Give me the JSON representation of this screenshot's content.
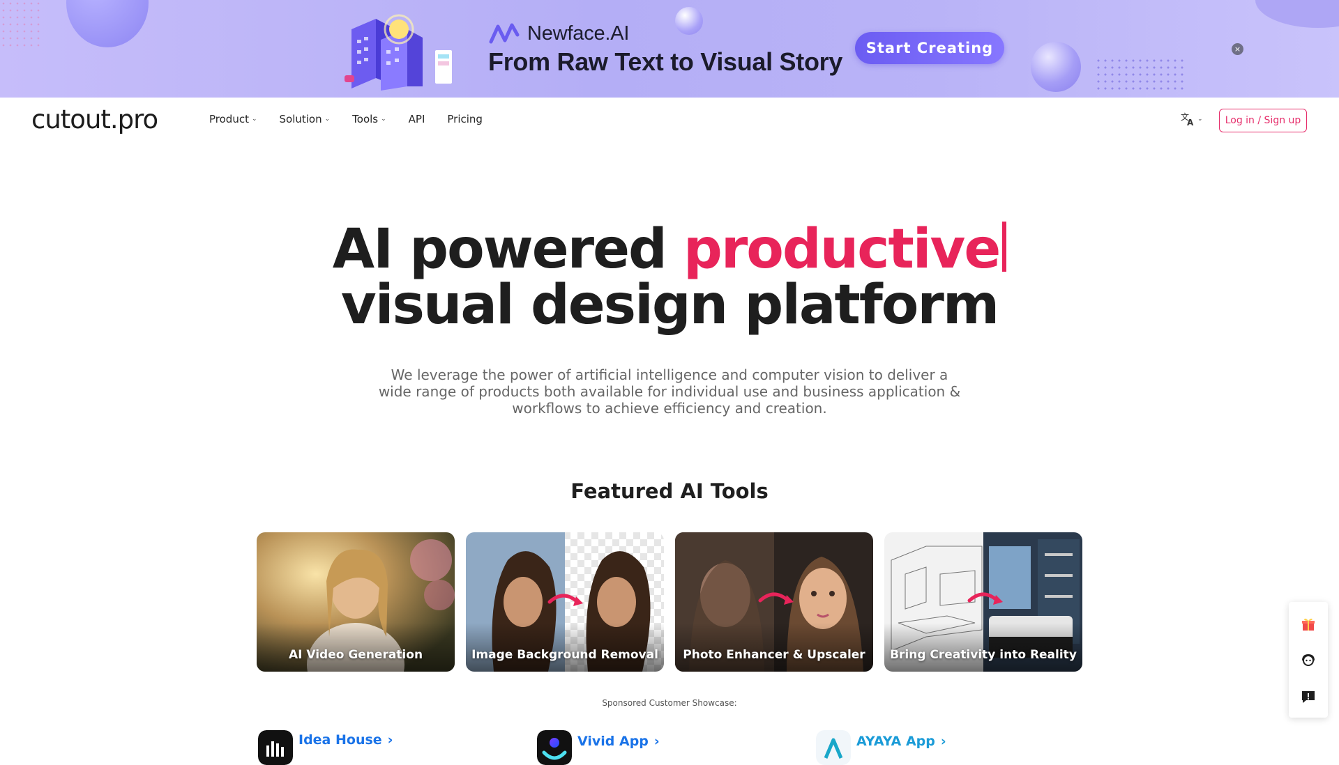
{
  "banner": {
    "brand_name": "Newface.AI",
    "headline": "From Raw Text to Visual Story",
    "cta_label": "Start Creating",
    "close_glyph": "×"
  },
  "nav": {
    "logo": "cutout.pro",
    "menu": [
      {
        "label": "Product",
        "has_dropdown": true
      },
      {
        "label": "Solution",
        "has_dropdown": true
      },
      {
        "label": "Tools",
        "has_dropdown": true
      },
      {
        "label": "API",
        "has_dropdown": false
      },
      {
        "label": "Pricing",
        "has_dropdown": false
      }
    ],
    "language_icon": "translate-icon",
    "login_label": "Log in / Sign up"
  },
  "hero": {
    "title_part1": "AI powered ",
    "title_accent": "productive",
    "title_line2": "visual design platform",
    "subtitle": "We leverage the power of artificial intelligence and computer vision to deliver a wide range of products both available for individual use and business application & workflows to achieve efficiency and creation."
  },
  "featured": {
    "title": "Featured AI Tools",
    "cards": [
      {
        "label": "AI Video Generation"
      },
      {
        "label": "Image Background Removal"
      },
      {
        "label": "Photo Enhancer & Upscaler"
      },
      {
        "label": "Bring Creativity into Reality"
      }
    ]
  },
  "showcase": {
    "label": "Sponsored Customer Showcase:",
    "apps": [
      {
        "name": "Idea House",
        "suffix": "›",
        "color": "#1a73e8"
      },
      {
        "name": "Vivid App",
        "suffix": "›",
        "color": "#1a73e8"
      },
      {
        "name": "AYAYA App",
        "suffix": "›",
        "color": "#1a9bd7"
      }
    ]
  },
  "side_panel": {
    "icons": [
      "gift-icon",
      "support-agent-icon",
      "feedback-icon"
    ]
  },
  "colors": {
    "accent": "#e8245a",
    "banner_cta": "#7665f7"
  }
}
